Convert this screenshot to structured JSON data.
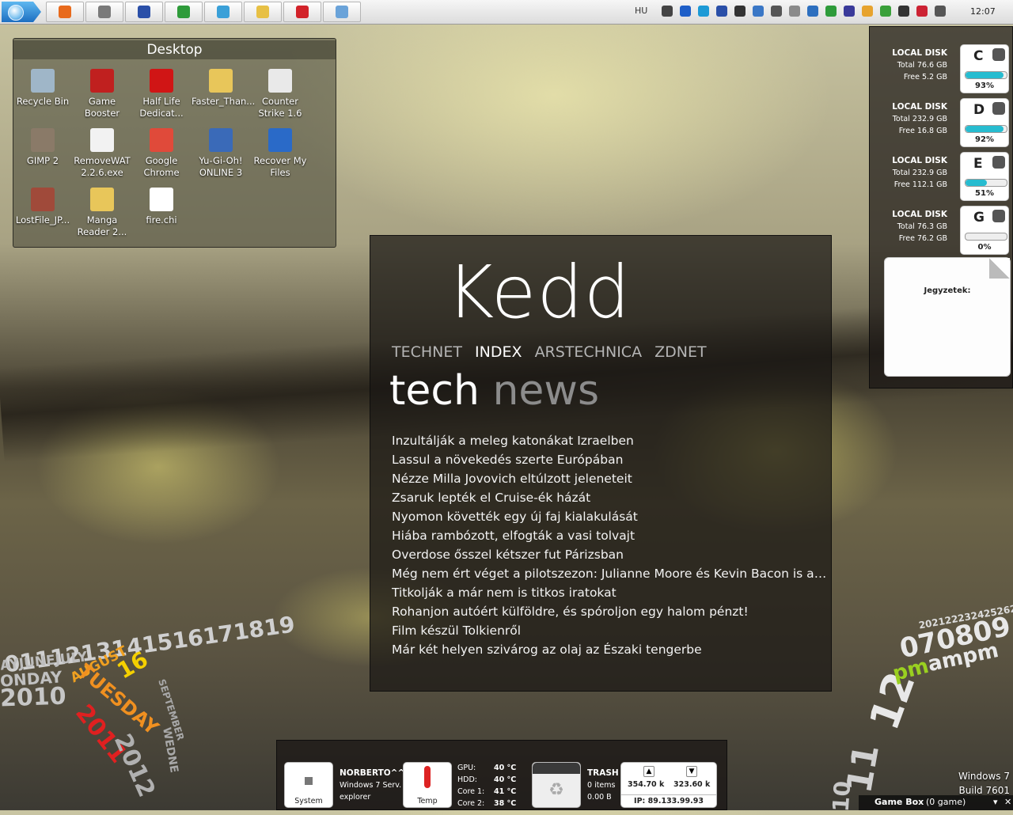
{
  "taskbar": {
    "language": "HU",
    "clock": "12:07",
    "start_label": "Start",
    "apps": [
      {
        "name": "firefox-icon",
        "color": "#e86a1c"
      },
      {
        "name": "media-app-icon",
        "color": "#7a7a7a"
      },
      {
        "name": "save-app-icon",
        "color": "#2a4fa8"
      },
      {
        "name": "utorrent-icon",
        "color": "#2e9b3a"
      },
      {
        "name": "messenger-icon",
        "color": "#3aa0d8"
      },
      {
        "name": "folder-icon",
        "color": "#e7c045"
      },
      {
        "name": "game-booster-icon",
        "color": "#d2232a"
      },
      {
        "name": "tool-app-icon",
        "color": "#6aa3d9"
      }
    ],
    "tray": [
      {
        "name": "network-icon",
        "color": "#444"
      },
      {
        "name": "bluetooth-icon",
        "color": "#1f5fc8"
      },
      {
        "name": "media-icon",
        "color": "#1c9ad6"
      },
      {
        "name": "disk-icon",
        "color": "#2a4fa8"
      },
      {
        "name": "window-icon",
        "color": "#333"
      },
      {
        "name": "users-icon",
        "color": "#3a77c6"
      },
      {
        "name": "speaker-icon",
        "color": "#555"
      },
      {
        "name": "drop-icon",
        "color": "#8a8a8a"
      },
      {
        "name": "monitor-icon",
        "color": "#2d6fbf"
      },
      {
        "name": "utorrent-tray-icon",
        "color": "#2e9b3a"
      },
      {
        "name": "gpu-icon",
        "color": "#3a3a9a"
      },
      {
        "name": "lock-icon",
        "color": "#e7a32e"
      },
      {
        "name": "shield-check-icon",
        "color": "#3aa03a"
      },
      {
        "name": "flag-icon",
        "color": "#333"
      },
      {
        "name": "network-error-icon",
        "color": "#c23"
      },
      {
        "name": "volume-icon",
        "color": "#555"
      }
    ]
  },
  "desktop_fence": {
    "title": "Desktop",
    "icons": [
      {
        "label": "Recycle Bin",
        "color": "#9fb6c8"
      },
      {
        "label": "Game Booster",
        "color": "#c0201f"
      },
      {
        "label": "Half Life Dedicat...",
        "color": "#d01515"
      },
      {
        "label": "Faster_Than...",
        "color": "#e8c65a"
      },
      {
        "label": "Counter Strike 1.6",
        "color": "#e9e9e9"
      },
      {
        "label": "GIMP 2",
        "color": "#8a7a68"
      },
      {
        "label": "RemoveWAT 2.2.6.exe",
        "color": "#f2f2f2"
      },
      {
        "label": "Google Chrome",
        "color": "#e04a3a"
      },
      {
        "label": "Yu-Gi-Oh! ONLINE 3",
        "color": "#3a6ab8"
      },
      {
        "label": "Recover My Files",
        "color": "#2a6ac8"
      },
      {
        "label": "LostFile_JP...",
        "color": "#a04a3a"
      },
      {
        "label": "Manga Reader 2...",
        "color": "#e8c65a"
      },
      {
        "label": "fire.chi",
        "color": "#ffffff"
      }
    ]
  },
  "news": {
    "day": "Kedd",
    "tabs": [
      "TECHNET",
      "INDEX",
      "ARSTECHNICA",
      "ZDNET"
    ],
    "active_tab": "INDEX",
    "heading_primary": "tech",
    "heading_secondary": "news",
    "items": [
      "Inzultálják a meleg katonákat Izraelben",
      "Lassul a növekedés szerte Európában",
      "Nézze Milla Jovovich eltúlzott jeleneteit",
      "Zsaruk lepték el Cruise-ék házát",
      "Nyomon követték egy új faj kialakulását",
      "Hiába rambózott, elfogták a vasi tolvajt",
      "Overdose ősszel kétszer fut Párizsban",
      "Még nem ért véget a pilotszezon: Julianne Moore és Kevin Bacon is a tév...",
      "Titkolják a már nem is titkos iratokat",
      "Rohanjon autóért külföldre, és spóroljon egy halom pénzt!",
      "Film készül Tolkienről",
      "Már két helyen szivárog az olaj az Északi tengerbe"
    ]
  },
  "disks": [
    {
      "title": "LOCAL DISK",
      "total": "Total 76.6 GB",
      "free": "Free 5.2 GB",
      "letter": "C",
      "percent": "93%",
      "fill": 0.93
    },
    {
      "title": "LOCAL DISK",
      "total": "Total 232.9 GB",
      "free": "Free 16.8 GB",
      "letter": "D",
      "percent": "92%",
      "fill": 0.92
    },
    {
      "title": "LOCAL DISK",
      "total": "Total 232.9 GB",
      "free": "Free 112.1 GB",
      "letter": "E",
      "percent": "51%",
      "fill": 0.51
    },
    {
      "title": "LOCAL DISK",
      "total": "Total 76.3 GB",
      "free": "Free 76.2 GB",
      "letter": "G",
      "percent": "0%",
      "fill": 0.0
    }
  ],
  "notes": {
    "title": "Jegyzetek:"
  },
  "calendar": {
    "days_row": "0111213141516171819",
    "months": "AYJUNEJULY",
    "month_active": "AUGUST",
    "month_next": "SEPTEMBER",
    "weekday_prev": "ONDAY",
    "weekday_active": "TUESDAY",
    "weekday_next": "WEDNE",
    "day_active": "16",
    "year_prev": "2010",
    "year_active": "2011",
    "year_next": "2012"
  },
  "clock_spiral": {
    "minutes": "2021222324252627",
    "hours_row": "070809",
    "hour_active": "12",
    "hour_prev": "11",
    "ampm_active": "pm",
    "ampm_rest": "ampm",
    "trail": "10"
  },
  "os": {
    "name": "Windows 7",
    "build": "Build 7601"
  },
  "dock": {
    "system_label": "System",
    "user": "NORBERTO^^",
    "os": "Windows 7 Serv.",
    "process": "explorer",
    "temp_label": "Temp",
    "temps": [
      {
        "label": "GPU:",
        "value": "40  °C"
      },
      {
        "label": "HDD:",
        "value": "40  °C"
      },
      {
        "label": "Core 1:",
        "value": "41  °C"
      },
      {
        "label": "Core 2:",
        "value": "38  °C"
      }
    ],
    "trash_title": "TRASH",
    "trash_items": "0 items",
    "trash_size": "0.00 B",
    "upload": "354.70 k",
    "download": "323.60 k",
    "ip": "IP: 89.133.99.93"
  },
  "gamebox": {
    "title": "Game Box",
    "status": "(0 game)"
  }
}
